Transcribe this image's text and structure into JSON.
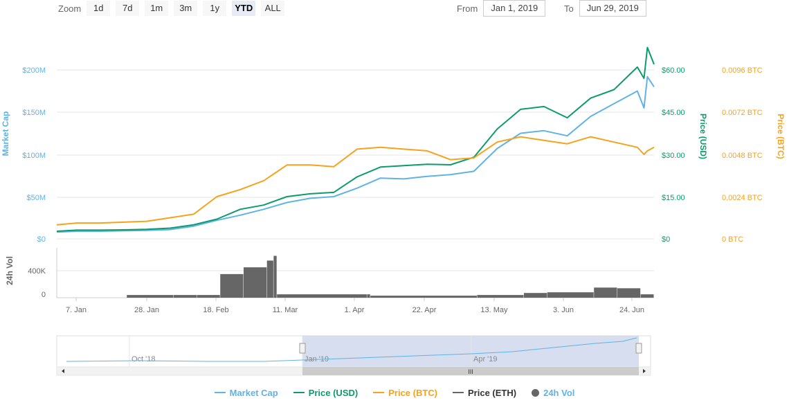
{
  "toolbar": {
    "zoom_label": "Zoom",
    "zoom_buttons": [
      "1d",
      "7d",
      "1m",
      "3m",
      "1y",
      "YTD",
      "ALL"
    ],
    "active_zoom": "YTD",
    "from_label": "From",
    "from_value": "Jan 1, 2019",
    "to_label": "To",
    "to_value": "Jun 29, 2019"
  },
  "colors": {
    "market_cap": "#5fb3e6",
    "price_usd": "#0c9b6c",
    "price_btc": "#f7a21b",
    "price_eth": "#666666",
    "volume": "#666666",
    "navigator_fill": "#ccd6eb"
  },
  "chart_data": {
    "type": "line",
    "x_range": [
      "2019-01-01",
      "2019-06-29"
    ],
    "x_ticks": [
      "7. Jan",
      "28. Jan",
      "18. Feb",
      "11. Mar",
      "1. Apr",
      "22. Apr",
      "13. May",
      "3. Jun",
      "24. Jun"
    ],
    "axes": {
      "market_cap": {
        "label": "Market Cap",
        "ticks": [
          "$0",
          "$50M",
          "$100M",
          "$150M",
          "$200M"
        ],
        "range": [
          0,
          200000000
        ]
      },
      "price_usd": {
        "label": "Price (USD)",
        "ticks": [
          "$0",
          "$15.00",
          "$30.00",
          "$45.00",
          "$60.00"
        ],
        "range": [
          0,
          60
        ]
      },
      "price_btc": {
        "label": "Price (BTC)",
        "ticks": [
          "0 BTC",
          "0.0024 BTC",
          "0.0048 BTC",
          "0.0072 BTC",
          "0.0096 BTC"
        ],
        "range": [
          0,
          0.0096
        ]
      },
      "volume": {
        "label": "24h Vol",
        "ticks": [
          "0",
          "400K"
        ],
        "range": [
          0,
          400000
        ]
      }
    },
    "series": [
      {
        "name": "Market Cap",
        "dates": [
          "2019-01-01",
          "2019-01-07",
          "2019-01-14",
          "2019-01-21",
          "2019-01-28",
          "2019-02-04",
          "2019-02-11",
          "2019-02-18",
          "2019-02-25",
          "2019-03-04",
          "2019-03-11",
          "2019-03-18",
          "2019-03-25",
          "2019-04-01",
          "2019-04-08",
          "2019-04-15",
          "2019-04-22",
          "2019-04-29",
          "2019-05-06",
          "2019-05-13",
          "2019-05-20",
          "2019-05-27",
          "2019-06-03",
          "2019-06-10",
          "2019-06-17",
          "2019-06-24",
          "2019-06-26",
          "2019-06-27",
          "2019-06-29"
        ],
        "values": [
          8000000,
          9000000,
          9000000,
          9500000,
          10000000,
          11000000,
          15000000,
          22000000,
          28000000,
          35000000,
          43000000,
          48000000,
          50000000,
          60000000,
          72000000,
          71000000,
          74000000,
          76000000,
          80000000,
          107000000,
          125000000,
          128000000,
          122000000,
          145000000,
          160000000,
          175000000,
          155000000,
          192000000,
          180000000
        ]
      },
      {
        "name": "Price (USD)",
        "dates": [
          "2019-01-01",
          "2019-01-07",
          "2019-01-14",
          "2019-01-21",
          "2019-01-28",
          "2019-02-04",
          "2019-02-11",
          "2019-02-18",
          "2019-02-25",
          "2019-03-04",
          "2019-03-11",
          "2019-03-18",
          "2019-03-25",
          "2019-04-01",
          "2019-04-08",
          "2019-04-15",
          "2019-04-22",
          "2019-04-29",
          "2019-05-06",
          "2019-05-13",
          "2019-05-20",
          "2019-05-27",
          "2019-06-03",
          "2019-06-10",
          "2019-06-17",
          "2019-06-24",
          "2019-06-26",
          "2019-06-27",
          "2019-06-29"
        ],
        "values": [
          2.7,
          3.1,
          3.1,
          3.2,
          3.4,
          3.8,
          5.0,
          7.0,
          10.5,
          12.0,
          15.0,
          16.0,
          16.5,
          22.0,
          25.5,
          26.0,
          26.5,
          26.3,
          29.0,
          39.0,
          46.0,
          47.0,
          43.0,
          50.0,
          53.0,
          61.0,
          57.0,
          68.0,
          62.0
        ]
      },
      {
        "name": "Price (BTC)",
        "dates": [
          "2019-01-01",
          "2019-01-07",
          "2019-01-14",
          "2019-01-21",
          "2019-01-28",
          "2019-02-04",
          "2019-02-11",
          "2019-02-18",
          "2019-02-25",
          "2019-03-04",
          "2019-03-11",
          "2019-03-18",
          "2019-03-25",
          "2019-04-01",
          "2019-04-08",
          "2019-04-15",
          "2019-04-22",
          "2019-04-29",
          "2019-05-06",
          "2019-05-13",
          "2019-05-20",
          "2019-05-27",
          "2019-06-03",
          "2019-06-10",
          "2019-06-17",
          "2019-06-24",
          "2019-06-26",
          "2019-06-27",
          "2019-06-29"
        ],
        "values": [
          0.0008,
          0.0009,
          0.0009,
          0.00095,
          0.001,
          0.0012,
          0.0014,
          0.0024,
          0.0028,
          0.0033,
          0.0042,
          0.0042,
          0.0041,
          0.0051,
          0.0052,
          0.0051,
          0.005,
          0.0045,
          0.0046,
          0.0055,
          0.0058,
          0.0056,
          0.0054,
          0.0058,
          0.0055,
          0.0052,
          0.0048,
          0.005,
          0.0052
        ]
      }
    ],
    "volume": {
      "name": "24h Vol",
      "dates": [
        "2019-01-01",
        "2019-01-15",
        "2019-01-22",
        "2019-02-05",
        "2019-02-12",
        "2019-02-19",
        "2019-02-26",
        "2019-03-05",
        "2019-03-07",
        "2019-03-08",
        "2019-04-04",
        "2019-04-05",
        "2019-05-07",
        "2019-05-21",
        "2019-05-28",
        "2019-06-11",
        "2019-06-18",
        "2019-06-25",
        "2019-06-29"
      ],
      "values": [
        0,
        0,
        40000,
        40000,
        40000,
        350000,
        450000,
        550000,
        620000,
        50000,
        50000,
        30000,
        40000,
        70000,
        80000,
        150000,
        140000,
        50000,
        40000
      ]
    },
    "navigator": {
      "ticks": [
        "Oct '18",
        "Jan '19",
        "Apr '19"
      ],
      "handle_label": "III"
    },
    "legend": [
      "Market Cap",
      "Price (USD)",
      "Price (BTC)",
      "Price (ETH)",
      "24h Vol"
    ]
  }
}
